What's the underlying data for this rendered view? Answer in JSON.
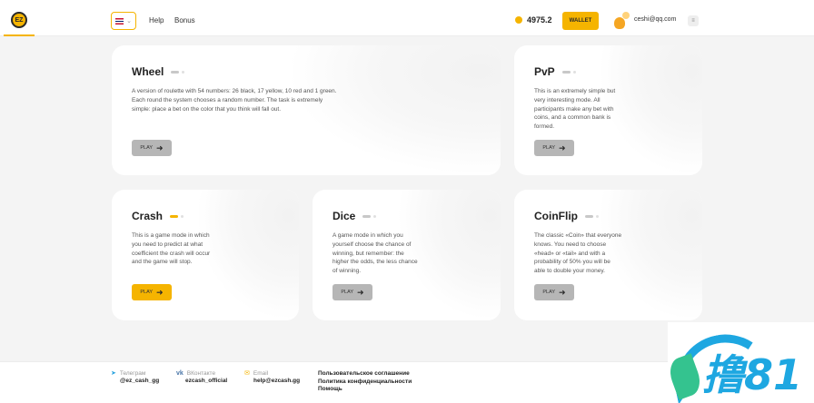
{
  "header": {
    "logo_text": "EZ",
    "nav": [
      "Help",
      "Bonus"
    ],
    "lang_chevron": "⌄",
    "balance": "4975.2",
    "wallet_label": "WALLET",
    "user_email": "ceshi@qq.com",
    "menu_glyph": "≡"
  },
  "games": [
    {
      "title": "Wheel",
      "description": "A version of roulette with 54 numbers: 26 black, 17 yellow, 10 red and 1 green.\nEach round the system chooses a random number. The task is extremely\nsimple: place a bet on the color that you think will fall out.",
      "play_label": "PLAY",
      "active": false
    },
    {
      "title": "PvP",
      "description": "This is an extremely simple but\nvery interesting mode. All\nparticipants make any bet with\ncoins, and a common bank is\nformed.",
      "play_label": "PLAY",
      "active": false
    },
    {
      "title": "Crash",
      "description": "This is a game mode in which\nyou need to predict at what\ncoefficient the crash will occur\nand the game will stop.",
      "play_label": "PLAY",
      "active": true
    },
    {
      "title": "Dice",
      "description": "A game mode in which you\nyourself choose the chance of\nwinning, but remember: the\nhigher the odds, the less chance\nof winning.",
      "play_label": "PLAY",
      "active": false
    },
    {
      "title": "CoinFlip",
      "description": "The classic «Coin» that everyone\nknows. You need to choose\n«head» or «tail» and with a\nprobability of 50% you will be\nable to double your money.",
      "play_label": "PLAY",
      "active": false
    }
  ],
  "footer": {
    "contacts": [
      {
        "label": "Телеграм",
        "value": "@ez_cash_gg",
        "icon": "telegram-icon"
      },
      {
        "label": "ВКонтакте",
        "value": "ezcash_official",
        "icon": "vk-icon"
      },
      {
        "label": "Email",
        "value": "help@ezcash.gg",
        "icon": "email-icon"
      }
    ],
    "links": [
      "Пользовательское соглашение",
      "Политика конфиденциальности",
      "Помощь"
    ]
  },
  "watermark_text": "撸81",
  "colors": {
    "accent": "#f5b400",
    "muted_button": "#b6b6b6",
    "watermark_blue": "#1ea7e1",
    "watermark_green": "#34c38f"
  }
}
